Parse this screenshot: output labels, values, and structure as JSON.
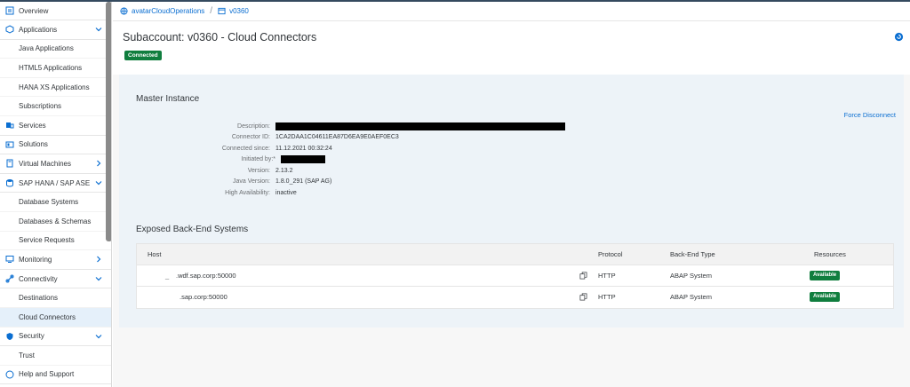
{
  "sidebar": {
    "items": [
      {
        "label": "Overview",
        "icon": "overview-icon"
      },
      {
        "label": "Applications",
        "icon": "applications-icon",
        "chevron": "down"
      },
      {
        "label": "Java Applications",
        "sub": true
      },
      {
        "label": "HTML5 Applications",
        "sub": true
      },
      {
        "label": "HANA XS Applications",
        "sub": true
      },
      {
        "label": "Subscriptions",
        "sub": true
      },
      {
        "label": "Services",
        "icon": "services-icon"
      },
      {
        "label": "Solutions",
        "icon": "solutions-icon"
      },
      {
        "label": "Virtual Machines",
        "icon": "virtual-machines-icon",
        "chevron": "right"
      },
      {
        "label": "SAP HANA / SAP ASE",
        "icon": "database-icon",
        "chevron": "down"
      },
      {
        "label": "Database Systems",
        "sub": true
      },
      {
        "label": "Databases & Schemas",
        "sub": true
      },
      {
        "label": "Service Requests",
        "sub": true
      },
      {
        "label": "Monitoring",
        "icon": "monitoring-icon",
        "chevron": "right"
      },
      {
        "label": "Connectivity",
        "icon": "connectivity-icon",
        "chevron": "down"
      },
      {
        "label": "Destinations",
        "sub": true
      },
      {
        "label": "Cloud Connectors",
        "sub": true,
        "selected": true
      },
      {
        "label": "Security",
        "icon": "security-icon",
        "chevron": "down"
      },
      {
        "label": "Trust",
        "sub": true
      },
      {
        "label": "Help and Support",
        "icon": "help-icon"
      }
    ]
  },
  "breadcrumb": {
    "items": [
      {
        "label": "avatarCloudOperations",
        "icon": "globe-icon"
      },
      {
        "label": "v0360",
        "icon": "subaccount-icon"
      }
    ],
    "separator": "/"
  },
  "header": {
    "title": "Subaccount: v0360 - Cloud Connectors",
    "status": "Connected"
  },
  "master": {
    "title": "Master Instance",
    "force_disconnect": "Force Disconnect",
    "fields": [
      {
        "label": "Description:",
        "value": "",
        "redacted": true
      },
      {
        "label": "Connector ID:",
        "value": "1CA2DAA1C04611EA87D6EA9E0AEF0EC3"
      },
      {
        "label": "Connected since:",
        "value": "11.12.2021 00:32:24"
      },
      {
        "label": "Initiated by:*",
        "value": "",
        "redacted": true
      },
      {
        "label": "Version:",
        "value": "2.13.2"
      },
      {
        "label": "Java Version:",
        "value": "1.8.0_291 (SAP AG)"
      },
      {
        "label": "High Availability:",
        "value": "inactive"
      }
    ]
  },
  "backend": {
    "title": "Exposed Back-End Systems",
    "columns": [
      "Host",
      "Protocol",
      "Back-End Type",
      "Resources"
    ],
    "rows": [
      {
        "host_prefix": "_",
        "host": ".wdf.sap.corp:50000",
        "protocol": "HTTP",
        "type": "ABAP System",
        "resources": "Available"
      },
      {
        "host_prefix": "",
        "host": ".sap.corp:50000",
        "protocol": "HTTP",
        "type": "ABAP System",
        "resources": "Available"
      }
    ]
  },
  "colors": {
    "accent": "#0a6ed1",
    "success": "#107e3e",
    "shell": "#354a5f"
  }
}
